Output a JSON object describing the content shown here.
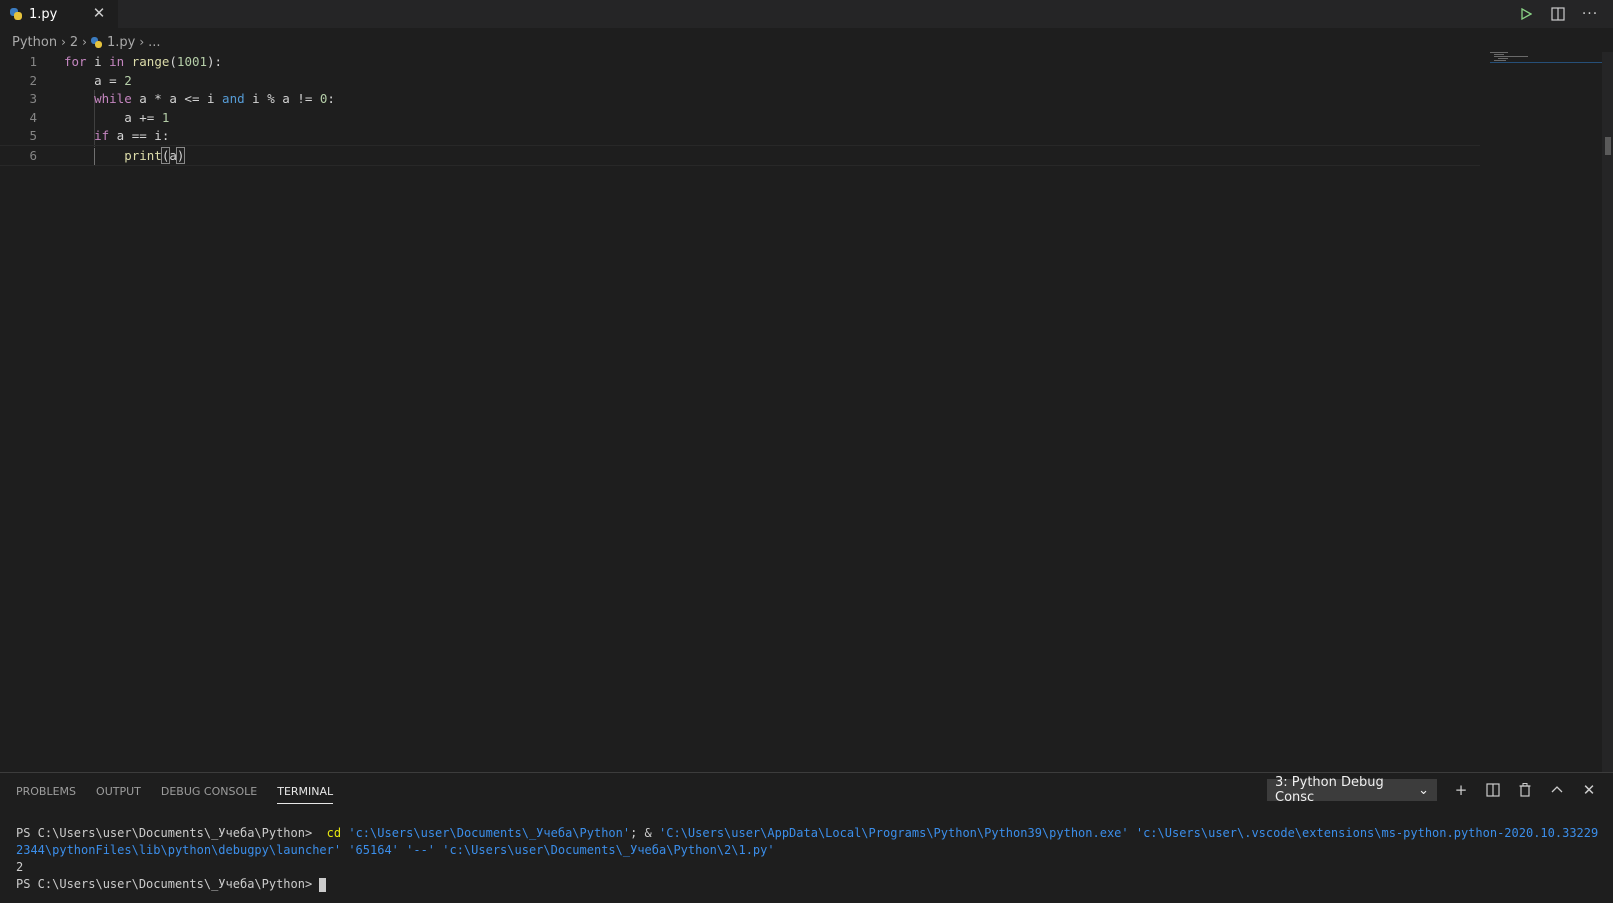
{
  "tab": {
    "filename": "1.py",
    "close_glyph": "✕"
  },
  "breadcrumb": {
    "items": [
      "Python",
      "2",
      "1.py",
      "..."
    ]
  },
  "editor": {
    "line_numbers": [
      "1",
      "2",
      "3",
      "4",
      "5",
      "6"
    ],
    "lines": [
      [
        [
          "kw",
          "for"
        ],
        [
          "plain",
          " i "
        ],
        [
          "kw",
          "in"
        ],
        [
          "plain",
          " "
        ],
        [
          "fn",
          "range"
        ],
        [
          "plain",
          "("
        ],
        [
          "num",
          "1001"
        ],
        [
          "plain",
          "):"
        ]
      ],
      [
        [
          "plain",
          "    a = "
        ],
        [
          "num",
          "2"
        ]
      ],
      [
        [
          "kw",
          "    while"
        ],
        [
          "plain",
          " a * a <= i "
        ],
        [
          "kw2",
          "and"
        ],
        [
          "plain",
          " i % a != "
        ],
        [
          "num",
          "0"
        ],
        [
          "plain",
          ":"
        ]
      ],
      [
        [
          "plain",
          "        a += "
        ],
        [
          "num",
          "1"
        ]
      ],
      [
        [
          "kw",
          "    if"
        ],
        [
          "plain",
          " a == i:"
        ]
      ],
      [
        [
          "fn",
          "        print"
        ],
        [
          "plain",
          "("
        ],
        [
          "plain",
          "a"
        ],
        [
          "plain",
          ")"
        ]
      ]
    ]
  },
  "panel": {
    "tabs": [
      "PROBLEMS",
      "OUTPUT",
      "DEBUG CONSOLE",
      "TERMINAL"
    ],
    "active_tab": "TERMINAL",
    "terminal_select": "3: Python Debug Consc",
    "terminal": {
      "prompt": "PS C:\\Users\\user\\Documents\\_Учеба\\Python> ",
      "cmd_cd": " cd ",
      "cmd_path1": "'c:\\Users\\user\\Documents\\_Учеба\\Python'",
      "cmd_sep": "; & ",
      "cmd_exe": "'C:\\Users\\user\\AppData\\Local\\Programs\\Python\\Python39\\python.exe'",
      "cmd_launcher": " 'c:\\Users\\user\\.vscode\\extensions\\ms-python.python-2020.10.332292344\\pythonFiles\\lib\\python\\debugpy\\launcher'",
      "cmd_port": " '65164'",
      "cmd_dash": " '--'",
      "cmd_file": " 'c:\\Users\\user\\Documents\\_Учеба\\Python\\2\\1.py'",
      "output": "2",
      "prompt2": "PS C:\\Users\\user\\Documents\\_Учеба\\Python> "
    }
  },
  "colors": {
    "accent_run": "#89d185",
    "python_blue": "#3b7bbf",
    "python_yellow": "#e5c33d"
  }
}
